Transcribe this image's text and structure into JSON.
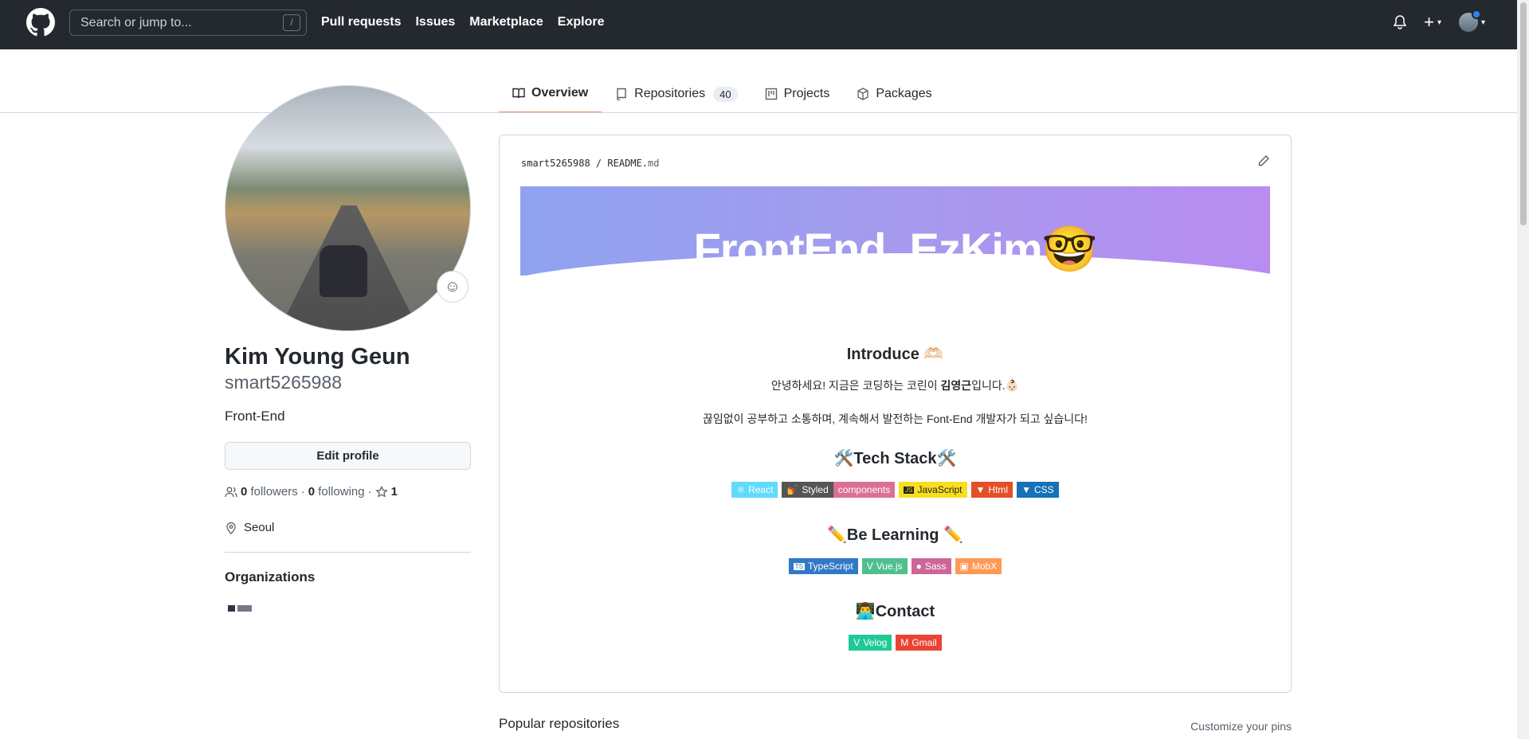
{
  "header": {
    "search_placeholder": "Search or jump to...",
    "search_shortcut": "/",
    "nav": [
      "Pull requests",
      "Issues",
      "Marketplace",
      "Explore"
    ],
    "plus_label": "+"
  },
  "tabs": [
    {
      "label": "Overview",
      "count": ""
    },
    {
      "label": "Repositories",
      "count": "40"
    },
    {
      "label": "Projects",
      "count": ""
    },
    {
      "label": "Packages",
      "count": ""
    }
  ],
  "profile": {
    "name": "Kim Young Geun",
    "login": "smart5265988",
    "bio": "Front-End",
    "edit_button": "Edit profile",
    "followers_count": "0",
    "followers_label": "followers",
    "following_count": "0",
    "following_label": "following",
    "stars": "1",
    "location": "Seoul",
    "organizations_title": "Organizations"
  },
  "readme": {
    "owner": "smart5265988",
    "file_name": "README.",
    "file_ext": "md",
    "banner_title": "FrontEnd_EzKim🤓",
    "introduce_title": "Introduce 🫶🏻",
    "intro_line1_prefix": "안녕하세요! 지금은 코딩하는 코린이 ",
    "intro_line1_bold": "김영근",
    "intro_line1_suffix": "입니다.👶🏻",
    "intro_line2": "끊임없이 공부하고 소통하며, 계속해서 발전하는 Font-End 개발자가 되고 싶습니다!",
    "tech_title": "🛠️Tech Stack🛠️",
    "tech_badges": [
      {
        "label": "React",
        "color": "#61dafb"
      },
      {
        "label": "Styled",
        "label2": "components",
        "color": "#db7093"
      },
      {
        "label": "JavaScript",
        "color": "#f7df1e"
      },
      {
        "label": "Html",
        "color": "#e34f26"
      },
      {
        "label": "CSS",
        "color": "#1572b6"
      }
    ],
    "learning_title": "✏️Be Learning ✏️",
    "learning_badges": [
      {
        "label": "TypeScript",
        "color": "#3178c6"
      },
      {
        "label": "Vue.js",
        "color": "#4fc08d"
      },
      {
        "label": "Sass",
        "color": "#cc6699"
      },
      {
        "label": "MobX",
        "color": "#ff9955"
      }
    ],
    "contact_title": "👨‍💻Contact",
    "contact_badges": [
      {
        "label": "Velog",
        "color": "#20c997"
      },
      {
        "label": "Gmail",
        "color": "#ea4335"
      }
    ]
  },
  "popular_title": "Popular repositories",
  "customize_pins": "Customize your pins"
}
